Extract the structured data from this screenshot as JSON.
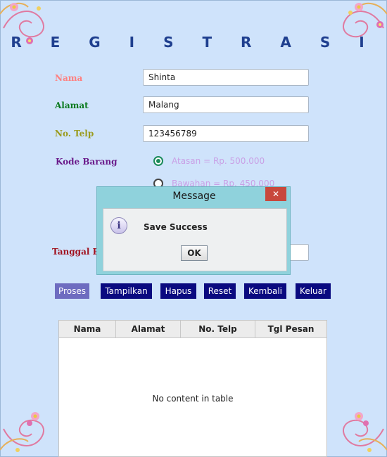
{
  "form": {
    "title": "R E G I S T R A S I",
    "labels": {
      "nama": "Nama",
      "alamat": "Alamat",
      "telp": "No. Telp",
      "kode": "Kode Barang",
      "tanggal": "Tanggal P"
    },
    "values": {
      "nama": "Shinta",
      "alamat": "Malang",
      "telp": "123456789"
    },
    "radio": [
      {
        "label": "Atasan = Rp. 500.000",
        "selected": true
      },
      {
        "label": "Bawahan = Rp. 450.000",
        "selected": false
      }
    ]
  },
  "buttons": [
    "Proses",
    "Tampilkan",
    "Hapus",
    "Reset",
    "Kembali",
    "Keluar"
  ],
  "table": {
    "columns": [
      "Nama",
      "Alamat",
      "No. Telp",
      "Tgl Pesan"
    ],
    "empty_text": "No content in table"
  },
  "dialog": {
    "title": "Message",
    "message": "Save Success",
    "ok": "OK",
    "close": "✕"
  },
  "colors": {
    "label_nama": "#ff7f7f",
    "label_alamat": "#0a7a1e",
    "label_telp": "#9b9b1e",
    "label_kode": "#6a1a8a",
    "label_tanggal": "#a0101e",
    "button_bg": "#0a0a80",
    "button_active_bg": "#6e6cc0"
  }
}
